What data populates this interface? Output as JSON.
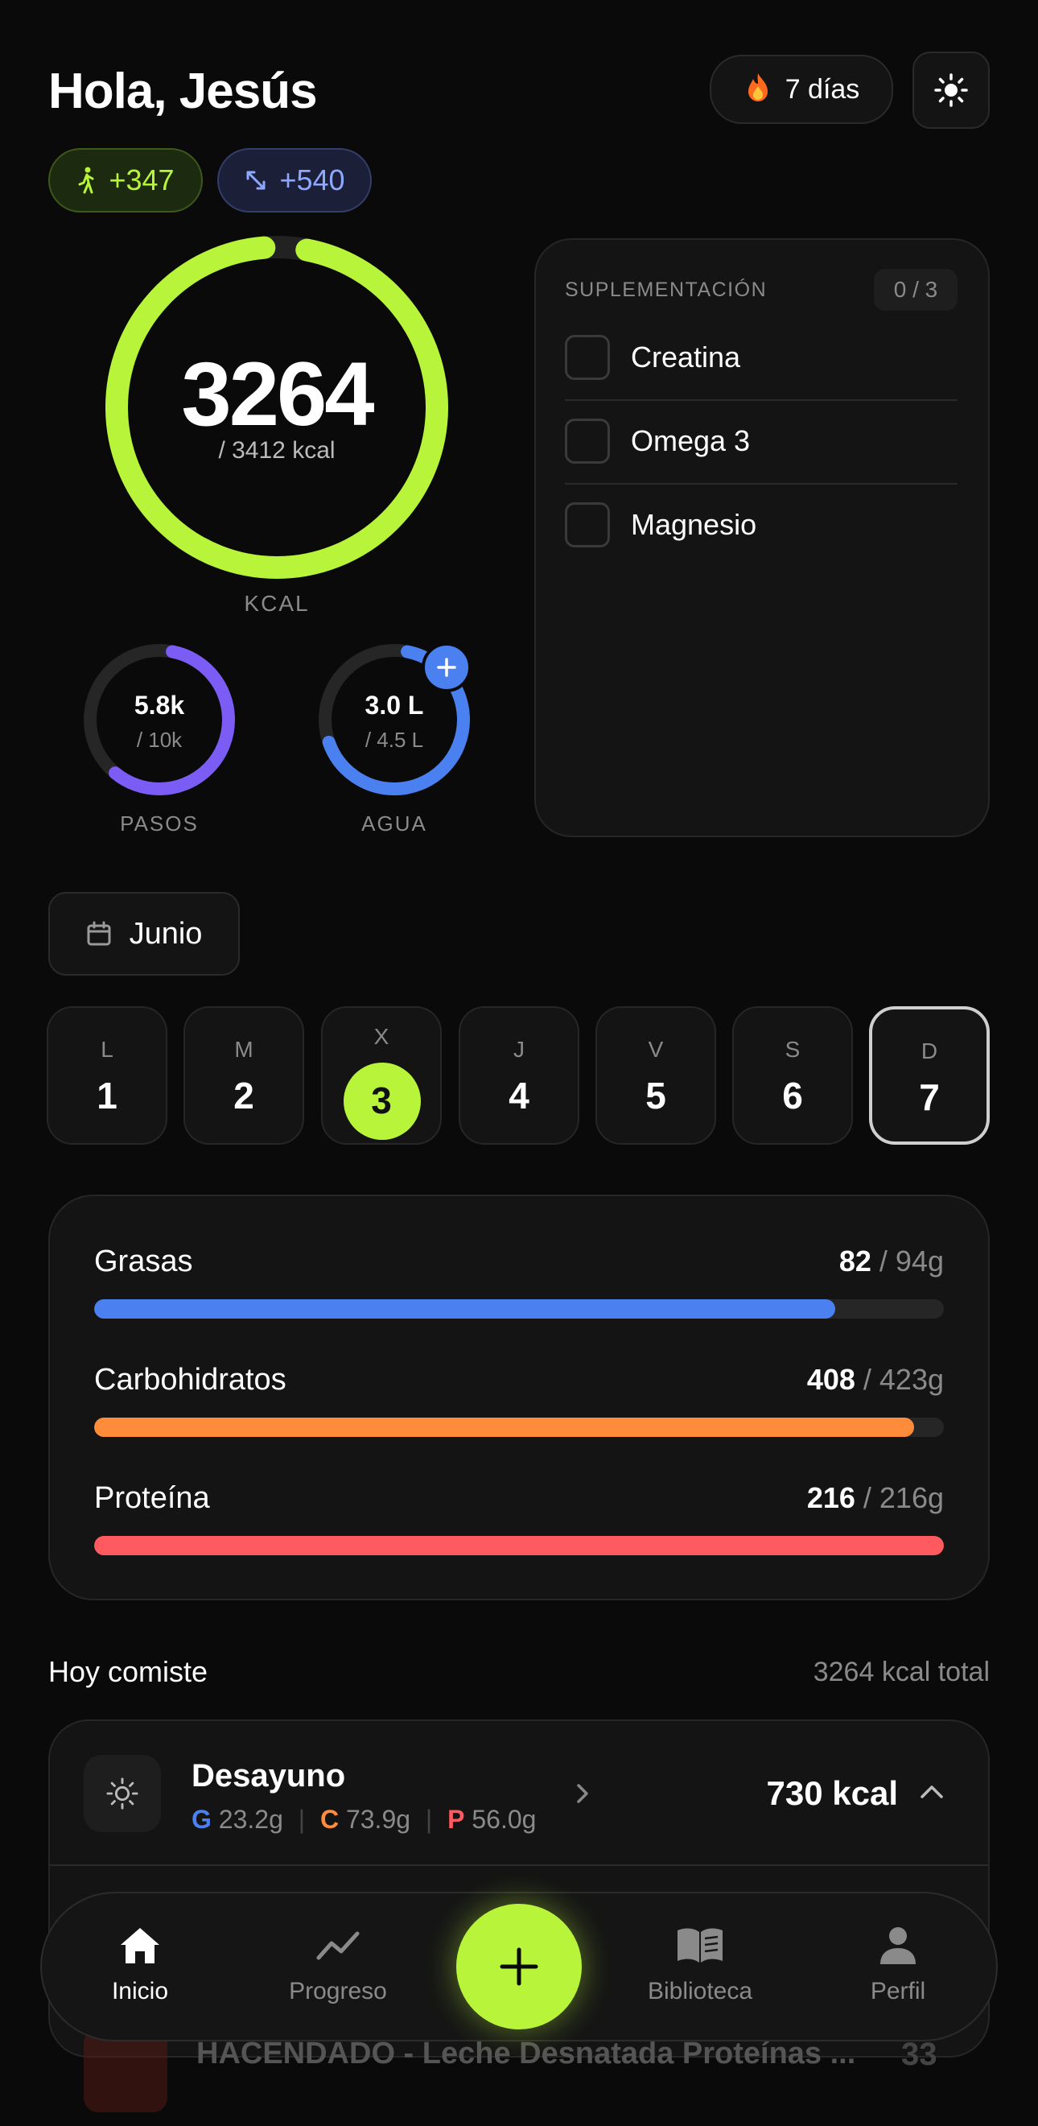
{
  "header": {
    "greeting": "Hola, Jesús",
    "streak": "7 días"
  },
  "badges": {
    "steps_bonus": "+347",
    "kcal_bonus": "+540"
  },
  "kcal": {
    "value": "3264",
    "goal": "/ 3412 kcal",
    "label": "KCAL",
    "progress": 0.957
  },
  "steps": {
    "value": "5.8k",
    "goal": "/ 10k",
    "label": "PASOS",
    "progress": 0.58
  },
  "water": {
    "value": "3.0 L",
    "goal": "/ 4.5 L",
    "label": "AGUA",
    "progress": 0.667
  },
  "supplements": {
    "title": "SUPLEMENTACIÓN",
    "count": "0 / 3",
    "items": [
      {
        "name": "Creatina"
      },
      {
        "name": "Omega 3"
      },
      {
        "name": "Magnesio"
      }
    ]
  },
  "month": {
    "label": "Junio"
  },
  "week": [
    {
      "letter": "L",
      "num": "1"
    },
    {
      "letter": "M",
      "num": "2"
    },
    {
      "letter": "X",
      "num": "3"
    },
    {
      "letter": "J",
      "num": "4"
    },
    {
      "letter": "V",
      "num": "5"
    },
    {
      "letter": "S",
      "num": "6"
    },
    {
      "letter": "D",
      "num": "7"
    }
  ],
  "macros": [
    {
      "name": "Grasas",
      "value": "82",
      "goal": "/ 94g",
      "progress": 0.872,
      "color": "#4a80f0"
    },
    {
      "name": "Carbohidratos",
      "value": "408",
      "goal": "/ 423g",
      "progress": 0.965,
      "color": "#ff8c3a"
    },
    {
      "name": "Proteína",
      "value": "216",
      "goal": "/ 216g",
      "progress": 1.0,
      "color": "#ff5a5f"
    }
  ],
  "today": {
    "title": "Hoy comiste",
    "total": "3264 kcal total"
  },
  "meal": {
    "name": "Desayuno",
    "kcal": "730 kcal",
    "g_label": "G",
    "g_val": "23.2g",
    "c_label": "C",
    "c_val": "73.9g",
    "p_label": "P",
    "p_val": "56.0g",
    "sep": "|"
  },
  "hidden_item": {
    "name": "HACENDADO - Leche Desnatada Proteínas ...",
    "kcal": "33"
  },
  "nav": {
    "home": "Inicio",
    "progress": "Progreso",
    "library": "Biblioteca",
    "profile": "Perfil"
  },
  "colors": {
    "accent": "#b8f53a",
    "blue": "#4a80f0",
    "purple": "#7b5cf5"
  }
}
